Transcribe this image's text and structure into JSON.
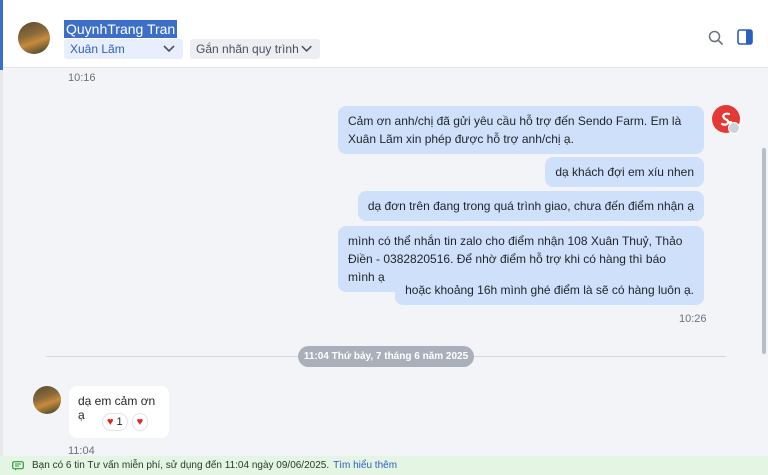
{
  "header": {
    "contact_name": "QuynhTrang Tran",
    "assignee": "Xuân Lãm",
    "label_dropdown": "Gắn nhãn quy trình"
  },
  "chat": {
    "time_top": "10:16",
    "outgoing": [
      "Cảm ơn anh/chị đã gửi yêu cầu hỗ trợ đến Sendo Farm. Em là Xuân Lãm xin phép được hỗ trợ anh/chị ạ.",
      "dạ khách đợi em xíu nhen",
      "dạ đơn trên đang trong quá trình giao, chưa đến điểm nhận ạ",
      "mình có thể nhắn tin zalo cho điểm nhận 108 Xuân Thuỷ, Thảo Điền - 0382820516. Để nhờ điểm hỗ trợ khi có hàng thì báo mình ạ",
      "hoặc khoảng 16h mình ghé điểm là sẽ có hàng luôn ạ."
    ],
    "time_outgoing": "10:26",
    "date_divider": "11:04 Thứ bảy, 7 tháng 6 năm 2025",
    "incoming": {
      "text": "dạ em cảm ơn ạ",
      "reaction_count": "1",
      "time": "11:04"
    }
  },
  "footer": {
    "text": "Bạn có 6 tin Tư vấn miễn phí, sử dụng đến 11:04 ngày 09/06/2025.",
    "link": "Tìm hiểu thêm"
  },
  "colors": {
    "accent": "#3d6fc9",
    "outgoing_bubble": "#cfe0fb",
    "brand_red": "#e53935",
    "footer_bg": "#e4f5e4"
  }
}
